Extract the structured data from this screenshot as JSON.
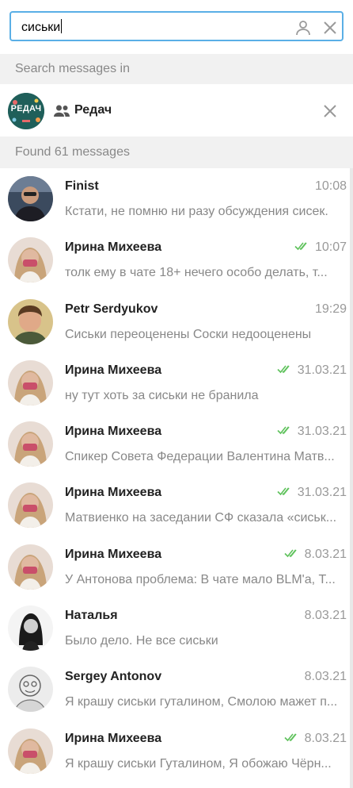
{
  "search": {
    "value": "сиськи"
  },
  "filter": {
    "header": "Search messages in",
    "chat_name": "Редач",
    "avatar_text": "РЕДАЧ"
  },
  "results": {
    "header": "Found 61 messages",
    "items": [
      {
        "sender": "Finist",
        "time": "10:08",
        "snippet": "Кстати, не помню ни разу обсуждения сисек.",
        "read": false,
        "avatar": "finist"
      },
      {
        "sender": "Ирина Михеева",
        "time": "10:07",
        "snippet": "толк ему в чате 18+ нечего особо делать, т...",
        "read": true,
        "avatar": "irina"
      },
      {
        "sender": "Petr Serdyukov",
        "time": "19:29",
        "snippet": "Сиськи переоценены Соски недооценены",
        "read": false,
        "avatar": "petr"
      },
      {
        "sender": "Ирина Михеева",
        "time": "31.03.21",
        "snippet": "ну тут хоть за сиськи не бранила",
        "read": true,
        "avatar": "irina"
      },
      {
        "sender": "Ирина Михеева",
        "time": "31.03.21",
        "snippet": "Спикер Совета Федерации Валентина Матв...",
        "read": true,
        "avatar": "irina"
      },
      {
        "sender": "Ирина Михеева",
        "time": "31.03.21",
        "snippet": "Матвиенко на заседании СФ сказала «сиськ...",
        "read": true,
        "avatar": "irina"
      },
      {
        "sender": "Ирина Михеева",
        "time": "8.03.21",
        "snippet": "У Антонова проблема: В чате мало BLM'а, Т...",
        "read": true,
        "avatar": "irina"
      },
      {
        "sender": "Наталья",
        "time": "8.03.21",
        "snippet": "Было дело. Не все сиськи",
        "read": false,
        "avatar": "natalya"
      },
      {
        "sender": "Sergey Antonov",
        "time": "8.03.21",
        "snippet": "Я крашу сиськи гуталином, Смолою мажет п...",
        "read": false,
        "avatar": "sergey"
      },
      {
        "sender": "Ирина Михеева",
        "time": "8.03.21",
        "snippet": "Я крашу сиськи Гуталином, Я обожаю Чёрн...",
        "read": true,
        "avatar": "irina"
      }
    ]
  },
  "colors": {
    "accent": "#5aafe6",
    "read_ticks": "#5fc25c",
    "section_bg": "#f1f1f1",
    "muted_text": "#888888"
  }
}
